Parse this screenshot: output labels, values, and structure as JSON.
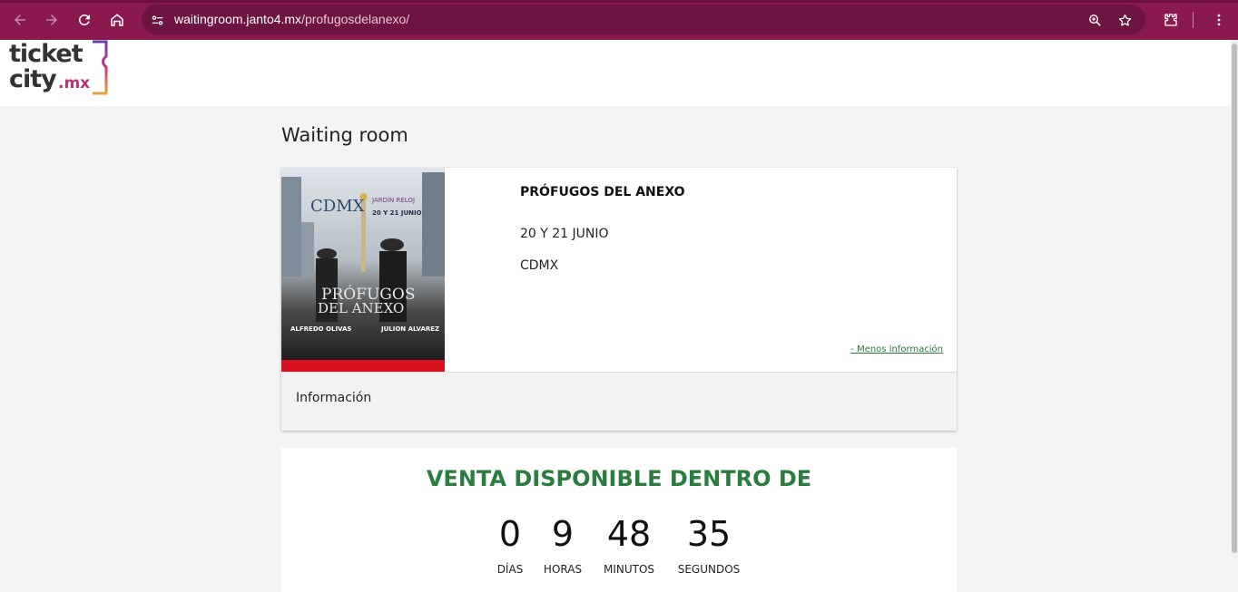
{
  "browser": {
    "url_host": "waitingroom.janto4.mx",
    "url_path": "/profugosdelanexo/"
  },
  "site": {
    "logo_ticket": "ticket",
    "logo_city": "city",
    "logo_mx": ".mx"
  },
  "page": {
    "title": "Waiting room"
  },
  "event": {
    "name": "PRÓFUGOS DEL ANEXO",
    "date": "20 Y 21 JUNIO",
    "city": "CDMX",
    "less_info": "- Menos información",
    "info_label": "Información",
    "poster": {
      "city": "CDMX",
      "venue": "JARDÍN RELOJ",
      "dates": "20 Y 21 JUNIO",
      "title_line1": "PRÓFUGOS",
      "title_line2": "DEL ANEXO",
      "artist_left": "ALFREDO OLIVAS",
      "artist_right": "JULION ALVAREZ"
    }
  },
  "countdown": {
    "title": "VENTA DISPONIBLE DENTRO DE",
    "days": "0",
    "days_label": "DÍAS",
    "hours": "9",
    "hours_label": "HORAS",
    "minutes": "48",
    "minutes_label": "MINUTOS",
    "seconds": "35",
    "seconds_label": "SEGUNDOS"
  },
  "colors": {
    "chrome": "#8a1a4e",
    "accent_green": "#2a7d3e",
    "logo_pink": "#b5327a"
  }
}
